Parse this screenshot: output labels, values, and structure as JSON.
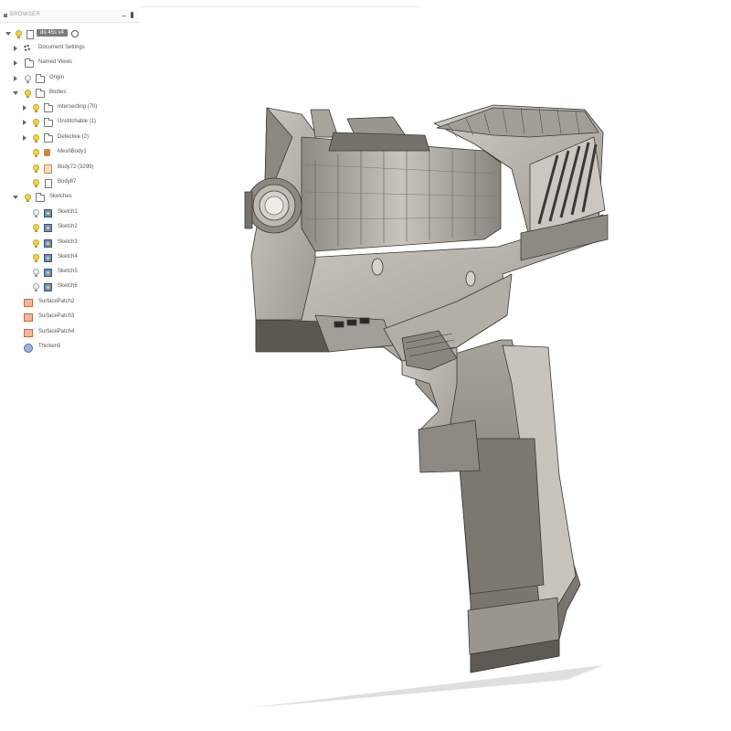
{
  "browser": {
    "title": "BROWSER",
    "root_label": "do 45s v4",
    "items": [
      {
        "label": "Document Settings"
      },
      {
        "label": "Named Views"
      },
      {
        "label": "Origin"
      },
      {
        "label": "Bodies"
      },
      {
        "label": "Intersecting (70)"
      },
      {
        "label": "Unstitchable (1)"
      },
      {
        "label": "Defective (2)"
      },
      {
        "label": "MeshBody1"
      },
      {
        "label": "Body72 (3299)"
      },
      {
        "label": "Body87"
      },
      {
        "label": "Sketches"
      },
      {
        "label": "Sketch1"
      },
      {
        "label": "Sketch2"
      },
      {
        "label": "Sketch3"
      },
      {
        "label": "Sketch4"
      },
      {
        "label": "Sketch5"
      },
      {
        "label": "Sketch6"
      },
      {
        "label": "SurfacePatch2"
      },
      {
        "label": "SurfacePatch3"
      },
      {
        "label": "SurfacePatch4"
      },
      {
        "label": "Thicken5"
      }
    ]
  },
  "colors": {
    "model_fill": "#b9b4ac",
    "model_dark": "#6f6a63",
    "model_edge": "#3b3935",
    "bulb_on": "#f6d43c"
  }
}
